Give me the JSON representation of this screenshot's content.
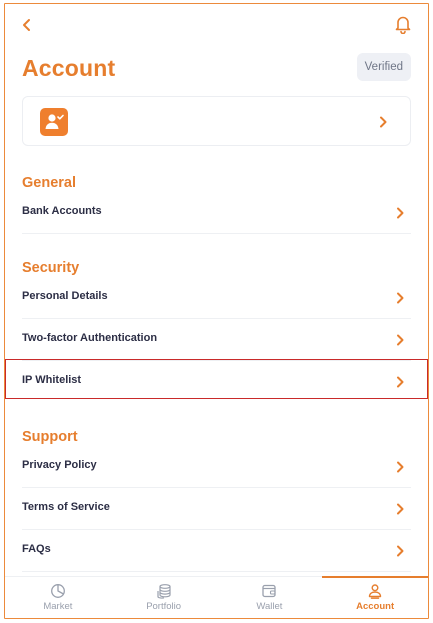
{
  "header": {
    "back_icon": "chevron-left-icon",
    "bell_icon": "bell-icon",
    "title": "Account",
    "verified_label": "Verified"
  },
  "profile_card": {
    "avatar_icon": "user-check-icon"
  },
  "sections": {
    "general": {
      "title": "General",
      "items": [
        {
          "label": "Bank Accounts"
        }
      ]
    },
    "security": {
      "title": "Security",
      "items": [
        {
          "label": "Personal Details"
        },
        {
          "label": "Two-factor Authentication"
        },
        {
          "label": "IP Whitelist"
        }
      ]
    },
    "support": {
      "title": "Support",
      "items": [
        {
          "label": "Privacy Policy"
        },
        {
          "label": "Terms of Service"
        },
        {
          "label": "FAQs"
        }
      ]
    }
  },
  "tabbar": {
    "tabs": [
      {
        "label": "Market",
        "icon": "pie-chart-icon",
        "active": false
      },
      {
        "label": "Portfolio",
        "icon": "coins-stack-icon",
        "active": false
      },
      {
        "label": "Wallet",
        "icon": "wallet-icon",
        "active": false
      },
      {
        "label": "Account",
        "icon": "user-icon",
        "active": true
      }
    ]
  },
  "colors": {
    "accent": "#e67e2e",
    "highlight_border": "#c92a2a",
    "text_dark": "#2c2e45",
    "inactive_tab": "#9aa0ad"
  }
}
